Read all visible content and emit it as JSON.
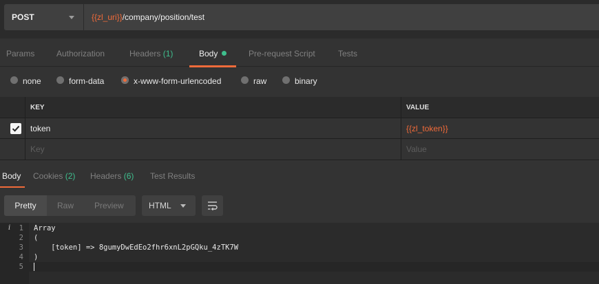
{
  "request": {
    "method": "POST",
    "url_variable": "{{zl_uri}}",
    "url_path": "/company/position/test"
  },
  "request_tabs": {
    "params": "Params",
    "authorization": "Authorization",
    "headers": "Headers",
    "headers_count": "(1)",
    "body": "Body",
    "prerequest": "Pre-request Script",
    "tests": "Tests"
  },
  "body_types": {
    "none": "none",
    "form_data": "form-data",
    "urlencoded": "x-www-form-urlencoded",
    "raw": "raw",
    "binary": "binary",
    "selected": "x-www-form-urlencoded"
  },
  "kv_table": {
    "key_header": "KEY",
    "value_header": "VALUE",
    "rows": [
      {
        "checked": true,
        "key": "token",
        "value": "{{zl_token}}"
      }
    ],
    "key_placeholder": "Key",
    "value_placeholder": "Value"
  },
  "response_tabs": {
    "body": "Body",
    "cookies": "Cookies",
    "cookies_count": "(2)",
    "headers": "Headers",
    "headers_count": "(6)",
    "test_results": "Test Results"
  },
  "response_toolbar": {
    "pretty": "Pretty",
    "raw": "Raw",
    "preview": "Preview",
    "language": "HTML",
    "wrap_icon": "wrap-lines-icon"
  },
  "editor": {
    "info_marker": "i",
    "lines": [
      {
        "num": "1",
        "text": "Array"
      },
      {
        "num": "2",
        "text": "("
      },
      {
        "num": "3",
        "text": "    [token] => 8gumyDwEdEo2fhr6xnL2pGQku_4zTK7W"
      },
      {
        "num": "4",
        "text": ")"
      },
      {
        "num": "5",
        "text": ""
      }
    ]
  },
  "colors": {
    "accent": "#f26b3a",
    "count_green": "#3fbf8e",
    "background": "#333333"
  }
}
